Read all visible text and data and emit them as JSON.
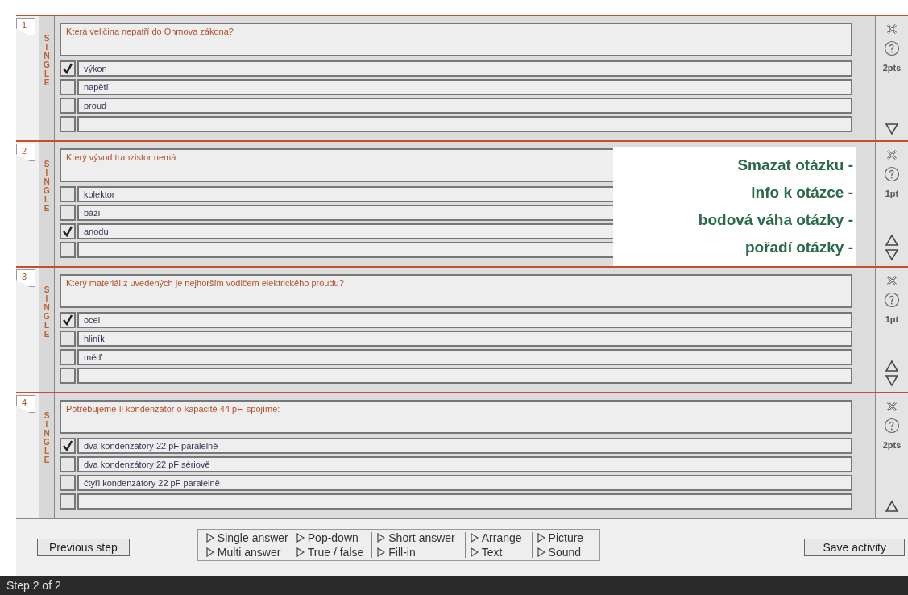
{
  "questions": [
    {
      "number": "1",
      "type_label": "SINGLE",
      "text": "Která veličina nepatří do Ohmova zákona?",
      "points": "2pts",
      "can_move_up": false,
      "can_move_down": true,
      "answers": [
        {
          "text": "výkon",
          "checked": true
        },
        {
          "text": "napětí",
          "checked": false
        },
        {
          "text": "proud",
          "checked": false
        },
        {
          "checked": false
        }
      ]
    },
    {
      "number": "2",
      "type_label": "SINGLE",
      "text": "Který vývod tranzistor nemá",
      "points": "1pt",
      "can_move_up": true,
      "can_move_down": true,
      "answers": [
        {
          "text": "kolektor",
          "checked": false
        },
        {
          "text": "bázi",
          "checked": false
        },
        {
          "text": "anodu",
          "checked": true
        },
        {
          "checked": false
        }
      ],
      "annotation": [
        "Smazat otázku -",
        "info k otázce -",
        "bodová váha otázky -",
        "pořadí otázky -"
      ]
    },
    {
      "number": "3",
      "type_label": "SINGLE",
      "text": "Který materiál z uvedených je nejhorším vodičem elektrického proudu?",
      "points": "1pt",
      "can_move_up": true,
      "can_move_down": true,
      "answers": [
        {
          "text": "ocel",
          "checked": true
        },
        {
          "text": "hliník",
          "checked": false
        },
        {
          "text": "měď",
          "checked": false
        },
        {
          "checked": false
        }
      ]
    },
    {
      "number": "4",
      "type_label": "SINGLE",
      "text": "Potřebujeme-li kondenzátor o kapacitě 44 pF, spojíme:",
      "points": "2pts",
      "can_move_up": true,
      "can_move_down": false,
      "answers": [
        {
          "text": "dva kondenzátory 22 pF paralelně",
          "checked": true
        },
        {
          "text": "dva kondenzátory 22 pF sériově",
          "checked": false
        },
        {
          "text": "čtyři kondenzátory 22 pF paralelně",
          "checked": false
        },
        {
          "checked": false
        }
      ]
    }
  ],
  "footer": {
    "previous_button": "Previous step",
    "add_question_groups": [
      [
        "Single answer",
        "Multi answer"
      ],
      [
        "Pop-down",
        "True / false"
      ],
      [
        "Short answer",
        "Fill-in"
      ],
      [
        "Arrange",
        "Text"
      ],
      [
        "Picture",
        "Sound"
      ]
    ],
    "save_button": "Save activity"
  },
  "status_bar": "Step 2 of 2"
}
